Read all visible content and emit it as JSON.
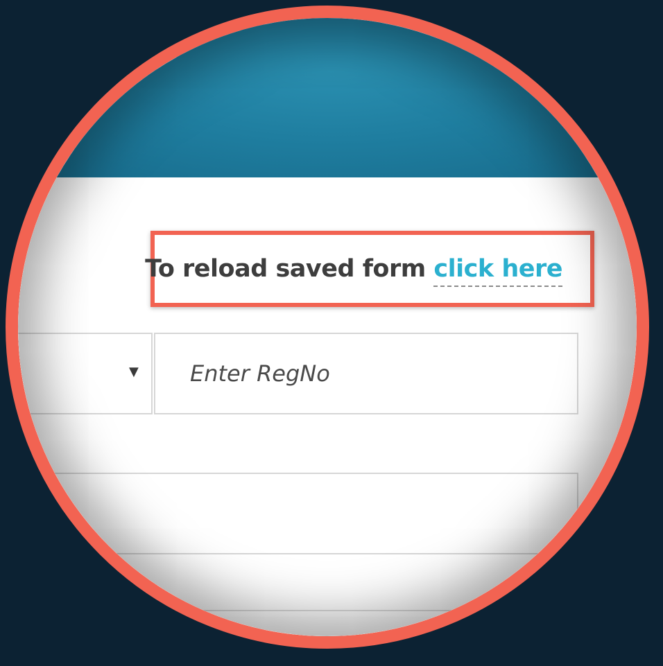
{
  "reload": {
    "prefix": "To reload saved form ",
    "link_label": "click here"
  },
  "form": {
    "regno_placeholder": "Enter RegNo",
    "select_arrow_icon": "triangle-down-icon"
  },
  "colors": {
    "background": "#0c2233",
    "lens_border": "#f26352",
    "header": "#1f7ea0",
    "link": "#2bb0cf",
    "highlight_box": "#f26352"
  }
}
